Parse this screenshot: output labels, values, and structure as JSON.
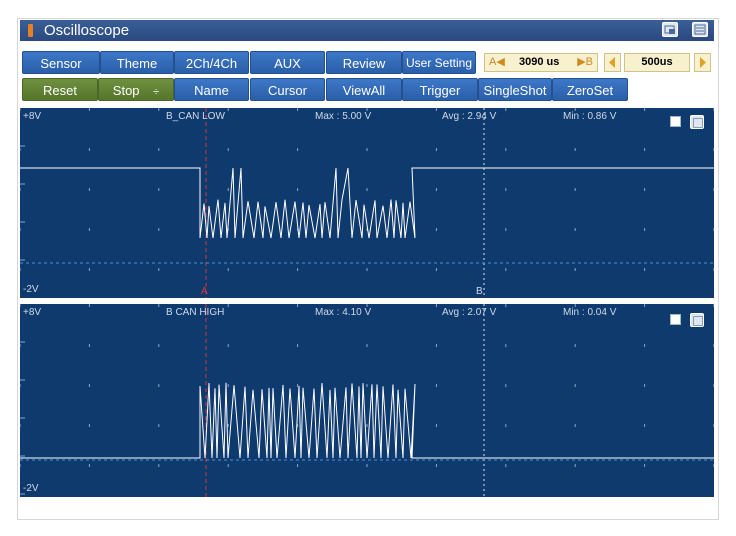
{
  "window": {
    "title": "Oscilloscope"
  },
  "toolbar_row1": [
    {
      "label": "Sensor"
    },
    {
      "label": "Theme"
    },
    {
      "label": "2Ch/4Ch"
    },
    {
      "label": "AUX"
    },
    {
      "label": "Review"
    },
    {
      "label": "User Setting"
    }
  ],
  "cursor_display": {
    "a_label": "A◀",
    "value": "3090 us",
    "b_label": "▶B"
  },
  "timebase": {
    "value": "500us"
  },
  "toolbar_row2": [
    {
      "label": "Reset",
      "style": "green"
    },
    {
      "label": "Stop",
      "style": "green"
    },
    {
      "label": "Name",
      "style": "blue"
    },
    {
      "label": "Cursor",
      "style": "blue"
    },
    {
      "label": "ViewAll",
      "style": "blue"
    },
    {
      "label": "Trigger",
      "style": "blue"
    },
    {
      "label": "SingleShot",
      "style": "blue"
    },
    {
      "label": "ZeroSet",
      "style": "blue"
    }
  ],
  "stop_spinner": "÷",
  "channels": [
    {
      "name": "B_CAN LOW",
      "vmax_label": "+8V",
      "vmin_label": "-2V",
      "max": "Max  : 5.00 V",
      "avg": "Avg  : 2.94 V",
      "min": "Min  : 0.86 V",
      "cursor_a_marker": "A",
      "cursor_b_marker": "B"
    },
    {
      "name": "B CAN HIGH",
      "vmax_label": "+8V",
      "vmin_label": "-2V",
      "max": "Max  : 4.10 V",
      "avg": "Avg  : 2.07 V",
      "min": "Min  : 0.04 V"
    }
  ],
  "colors": {
    "scope_bg": "#0f3a6e",
    "trace": "#ffffff",
    "cursor_a": "#d23a3a",
    "cursor_b": "#e6e6e6",
    "button_blue": "#2f6ab7",
    "button_green": "#5f7f34",
    "title_bar": "#2f5389"
  },
  "icons": {
    "app": "oscilloscope-icon",
    "window_controls": [
      "restore-icon",
      "menu-icon"
    ],
    "timebase_left": "arrow-left-icon",
    "timebase_right": "arrow-right-icon"
  }
}
